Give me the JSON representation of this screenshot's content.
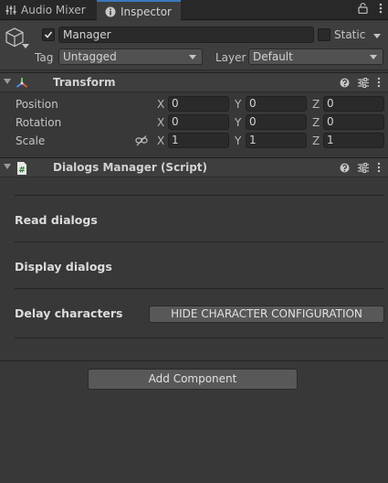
{
  "tabs": [
    {
      "label": "Audio Mixer",
      "icon": "audio-mixer-icon"
    },
    {
      "label": "Inspector",
      "icon": "info-icon"
    }
  ],
  "colors": {
    "accent": "#3a79bb",
    "panel": "#383838",
    "header": "#3e3e3e",
    "field": "#2a2a2a"
  },
  "gameobject": {
    "name": "Manager",
    "active": true,
    "static_label": "Static",
    "static": false,
    "tag_label": "Tag",
    "tag_value": "Untagged",
    "layer_label": "Layer",
    "layer_value": "Default"
  },
  "transform": {
    "title": "Transform",
    "rows": [
      {
        "label": "Position",
        "x": "0",
        "y": "0",
        "z": "0"
      },
      {
        "label": "Rotation",
        "x": "0",
        "y": "0",
        "z": "0"
      },
      {
        "label": "Scale",
        "x": "1",
        "y": "1",
        "z": "1"
      }
    ],
    "axes": [
      "X",
      "Y",
      "Z"
    ]
  },
  "script": {
    "title": "Dialogs Manager (Script)",
    "sections": [
      "Read dialogs",
      "Display dialogs",
      "Delay characters"
    ],
    "hide_button": "HIDE CHARACTER CONFIGURATION"
  },
  "add_component": "Add Component"
}
